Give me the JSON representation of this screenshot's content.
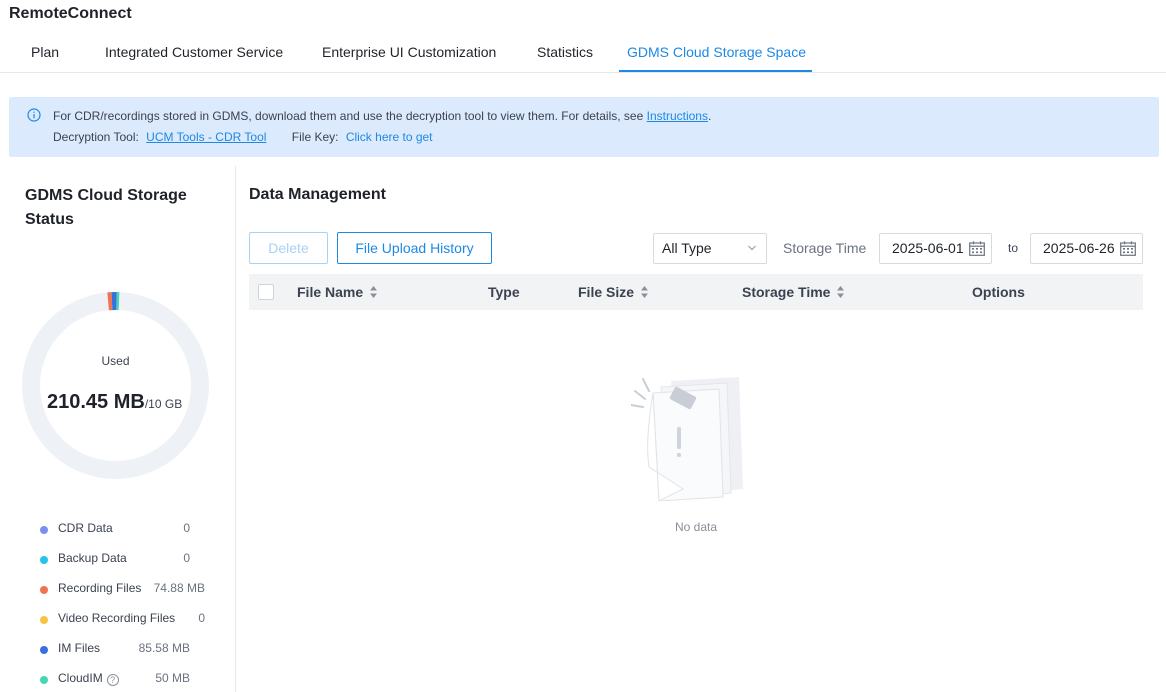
{
  "app": {
    "title": "RemoteConnect"
  },
  "tabs": [
    {
      "label": "Plan",
      "active": false
    },
    {
      "label": "Integrated Customer Service",
      "active": false
    },
    {
      "label": "Enterprise UI Customization",
      "active": false
    },
    {
      "label": "Statistics",
      "active": false
    },
    {
      "label": "GDMS Cloud Storage Space",
      "active": true
    }
  ],
  "notice": {
    "text": "For CDR/recordings stored in GDMS, download them and use the decryption tool to view them. For details, see",
    "instructions_link": "Instructions",
    "period": ".",
    "decryption_label": "Decryption Tool:",
    "decryption_link": "UCM Tools - CDR Tool",
    "file_key_label": "File Key:",
    "file_key_link": "Click here to get"
  },
  "status": {
    "title": "GDMS Cloud Storage Status",
    "used_label": "Used",
    "used_value": "210.45 MB",
    "total": "/10 GB",
    "used_fraction": 0.0206,
    "legend": [
      {
        "label": "CDR Data",
        "value": "0",
        "color": "#7b8ff0"
      },
      {
        "label": "Backup Data",
        "value": "0",
        "color": "#23c4e8"
      },
      {
        "label": "Recording Files",
        "value": "74.88 MB",
        "color": "#f07350"
      },
      {
        "label": "Video Recording Files",
        "value": "0",
        "color": "#f5c443"
      },
      {
        "label": "IM Files",
        "value": "85.58 MB",
        "color": "#3870e0"
      },
      {
        "label": "CloudIM",
        "value": "50 MB",
        "color": "#45d6b3"
      }
    ]
  },
  "management": {
    "title": "Data Management",
    "delete_label": "Delete",
    "history_label": "File Upload History",
    "type_filter": "All Type",
    "storage_time_label": "Storage Time",
    "date_from": "2025-06-01",
    "to_label": "to",
    "date_to": "2025-06-26",
    "columns": {
      "file_name": "File Name",
      "type": "Type",
      "file_size": "File Size",
      "storage_time": "Storage Time",
      "options": "Options"
    },
    "empty_text": "No data"
  },
  "colors": {
    "accent": "#1e88e5",
    "notice_bg": "#dbeafc",
    "donut_track": "#eef1f6"
  }
}
